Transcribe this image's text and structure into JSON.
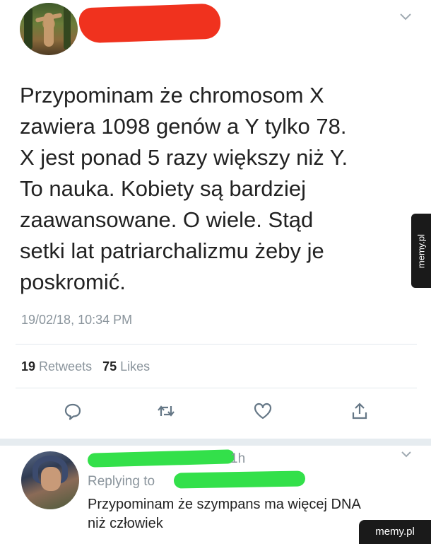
{
  "tweet": {
    "text": "Przypominam że chromosom X\nzawiera 1098 genów a Y tylko 78.\nX jest ponad 5 razy większy niż Y.\nTo nauka. Kobiety są bardziej\nzaawansowane. O wiele. Stąd\nsetki lat patriarchalizmu żeby je\nposkromić.",
    "timestamp": "19/02/18, 10:34 PM",
    "retweets_count": "19",
    "retweets_label": "Retweets",
    "likes_count": "75",
    "likes_label": "Likes",
    "actions": [
      "reply-icon",
      "retweet-icon",
      "like-icon",
      "share-icon"
    ]
  },
  "reply": {
    "time": "1h",
    "replying_to": "Replying to",
    "text": "Przypominam że szympans ma więcej DNA\nniż człowiek"
  },
  "watermarks": {
    "side": "memy.pl",
    "bottom": "memy.pl"
  },
  "colors": {
    "redaction_red": "#f0321e",
    "redaction_green": "#33e04a",
    "muted_text": "#8a949c"
  }
}
